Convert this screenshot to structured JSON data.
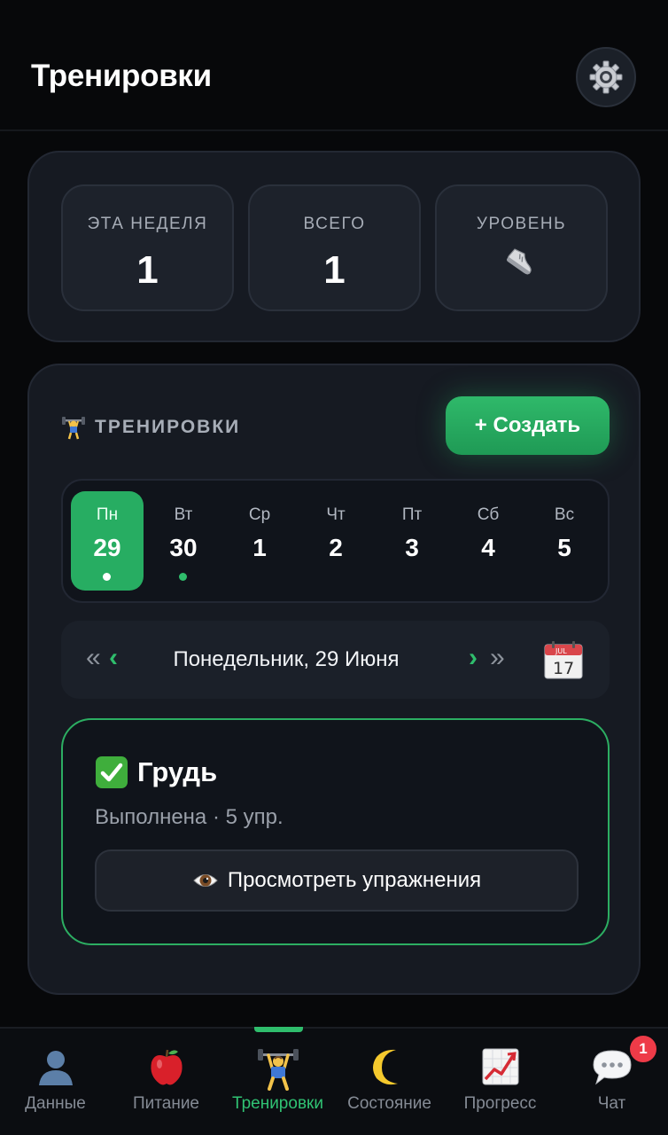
{
  "header": {
    "title": "Тренировки"
  },
  "stats": [
    {
      "label": "ЭТА НЕДЕЛЯ",
      "value": "1"
    },
    {
      "label": "ВСЕГО",
      "value": "1"
    },
    {
      "label": "УРОВЕНЬ",
      "icon": "sneaker-icon"
    }
  ],
  "workouts": {
    "section_title": "ТРЕНИРОВКИ",
    "create_label": "+ Создать",
    "week": [
      {
        "name": "Пн",
        "num": "29",
        "active": true,
        "has_dot": true
      },
      {
        "name": "Вт",
        "num": "30",
        "active": false,
        "has_dot": true
      },
      {
        "name": "Ср",
        "num": "1",
        "active": false,
        "has_dot": false
      },
      {
        "name": "Чт",
        "num": "2",
        "active": false,
        "has_dot": false
      },
      {
        "name": "Пт",
        "num": "3",
        "active": false,
        "has_dot": false
      },
      {
        "name": "Сб",
        "num": "4",
        "active": false,
        "has_dot": false
      },
      {
        "name": "Вс",
        "num": "5",
        "active": false,
        "has_dot": false
      }
    ],
    "date_nav": {
      "prev_week": "«",
      "prev_day": "‹",
      "date_label": "Понедельник, 29 Июня",
      "next_day": "›",
      "next_week": "»",
      "calendar_month": "JUL",
      "calendar_day": "17"
    },
    "session": {
      "name": "Грудь",
      "subtitle": "Выполнена · 5 упр.",
      "view_label": "Просмотреть упражнения"
    }
  },
  "tabbar": {
    "items": [
      {
        "label": "Данные",
        "icon": "user-silhouette-icon"
      },
      {
        "label": "Питание",
        "icon": "apple-icon"
      },
      {
        "label": "Тренировки",
        "icon": "weightlifter-icon",
        "active": true
      },
      {
        "label": "Состояние",
        "icon": "crescent-moon-icon"
      },
      {
        "label": "Прогресс",
        "icon": "chart-up-icon"
      },
      {
        "label": "Чат",
        "icon": "speech-bubble-icon"
      }
    ],
    "chat_badge": "1"
  },
  "colors": {
    "background": "#07080a",
    "card": "#161a22",
    "accent_green": "#27ad62",
    "badge_red": "#ee3b48",
    "muted_text": "#a7adb7"
  }
}
